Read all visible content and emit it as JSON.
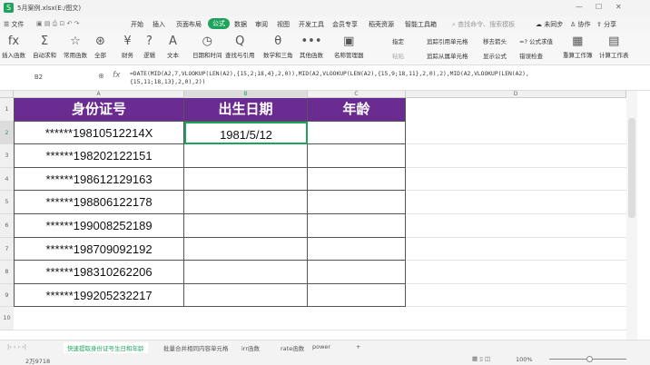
{
  "window": {
    "title": "5月案例.xlsx(E:/图文)"
  },
  "menu": {
    "file": "文件",
    "tabs": [
      "开始",
      "插入",
      "页面布局",
      "公式",
      "数据",
      "审阅",
      "视图",
      "开发工具",
      "会员专享",
      "稻壳资源",
      "智能工具箱"
    ],
    "active": "公式",
    "search": "查找命令、搜索模板",
    "sync": "未同步",
    "collab": "协作",
    "share": "分享"
  },
  "ribbon": {
    "buttons": [
      {
        "icon": "fx",
        "label": "插入函数"
      },
      {
        "icon": "Σ",
        "label": "自动求和"
      },
      {
        "icon": "☆",
        "label": "常用函数"
      },
      {
        "icon": "⊛",
        "label": "全部"
      },
      {
        "icon": "¥",
        "label": "财务"
      },
      {
        "icon": "?",
        "label": "逻辑"
      },
      {
        "icon": "A",
        "label": "文本"
      },
      {
        "icon": "◷",
        "label": "日期和时间"
      },
      {
        "icon": "Q",
        "label": "查找与引用"
      },
      {
        "icon": "θ",
        "label": "数学和三角"
      },
      {
        "icon": "•••",
        "label": "其他函数"
      },
      {
        "icon": "▣",
        "label": "名称管理器"
      }
    ],
    "small": [
      "指定",
      "粘贴",
      "追踪引用单元格",
      "追踪从属单元格",
      "移去箭头",
      "显示公式",
      "=? 公式求值",
      "错误检查"
    ],
    "right": [
      {
        "icon": "▦",
        "label": "重算工作簿"
      },
      {
        "icon": "▤",
        "label": "计算工作表"
      }
    ]
  },
  "formula_bar": {
    "name_box": "B2",
    "fx": "fx",
    "formula": "=DATE(MID(A2,7,VLOOKUP(LEN(A2),{15,2;18,4},2,0)),MID(A2,VLOOKUP(LEN(A2),{15,9;18,11},2,0),2),MID(A2,VLOOKUP(LEN(A2),\n{15,11;18,13},2,0),2))"
  },
  "columns": [
    "A",
    "B",
    "C",
    "D"
  ],
  "rows": [
    "1",
    "2",
    "3",
    "4",
    "5",
    "6",
    "7",
    "8",
    "9",
    "10"
  ],
  "table": {
    "headers": [
      "身份证号",
      "出生日期",
      "年龄"
    ],
    "ids": [
      "******19810512214X",
      "******198202122151",
      "******198612129163",
      "******198806122178",
      "******199008252189",
      "******198709092192",
      "******198310262206",
      "******199205232217"
    ],
    "birth": [
      "1981/5/12",
      "",
      "",
      "",
      "",
      "",
      "",
      ""
    ],
    "age": [
      "",
      "",
      "",
      "",
      "",
      "",
      "",
      ""
    ]
  },
  "sheets": {
    "tabs": [
      "快速提取身份证号生日和年龄",
      "批量合并相同内容单元格",
      "irr函数",
      "rate函数",
      "power"
    ],
    "active": 0
  },
  "status": {
    "count": "2万9718",
    "zoom": "100%"
  },
  "colors": {
    "accent": "#1fa35c",
    "header": "#6a2c91"
  }
}
